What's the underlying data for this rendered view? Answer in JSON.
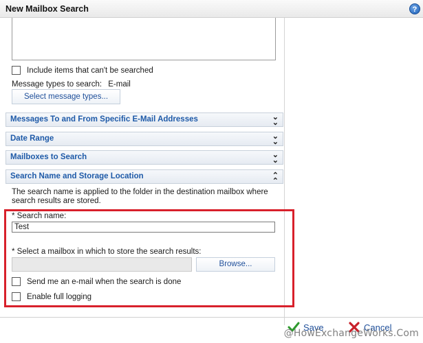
{
  "window": {
    "title": "New Mailbox Search",
    "help_icon": "?"
  },
  "options": {
    "include_unsearchable_label": "Include items that can't be searched",
    "message_types_label": "Message types to search:",
    "message_types_value": "E-mail",
    "select_message_types_label": "Select message types..."
  },
  "sections": [
    {
      "label": "Messages To and From Specific E-Mail Addresses",
      "expanded": false
    },
    {
      "label": "Date Range",
      "expanded": false
    },
    {
      "label": "Mailboxes to Search",
      "expanded": false
    },
    {
      "label": "Search Name and Storage Location",
      "expanded": true
    }
  ],
  "storage": {
    "description": "The search name is applied to the folder in the destination mailbox where search results are stored.",
    "search_name_label": "* Search name:",
    "search_name_value": "Test",
    "mailbox_label": "* Select a mailbox in which to store the search results:",
    "mailbox_value": "",
    "browse_label": "Browse...",
    "send_email_label": "Send me an e-mail when the search is done",
    "full_logging_label": "Enable full logging"
  },
  "footer": {
    "save_label": "Save",
    "cancel_label": "Cancel",
    "watermark": "@HowExchangeWorks.Com"
  },
  "colors": {
    "accent_red": "#d8202b",
    "section_text": "#1e5aa8",
    "save_green": "#2e9a2e",
    "cancel_red": "#c8202a"
  }
}
